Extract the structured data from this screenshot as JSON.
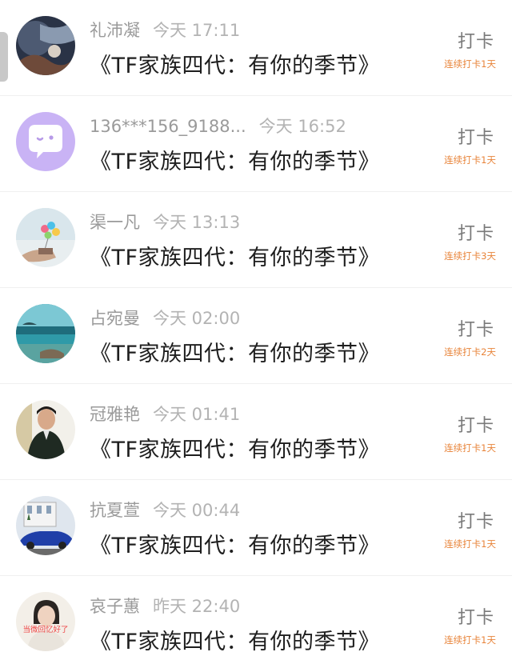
{
  "feed": {
    "items": [
      {
        "name": "礼沛凝",
        "time": "今天 17:11",
        "title": "《TF家族四代：有你的季节》",
        "action": "打卡",
        "streak": "连续打卡1天",
        "avatar": "dark-art-avatar"
      },
      {
        "name": "136***156_9188...",
        "time": "今天 16:52",
        "title": "《TF家族四代：有你的季节》",
        "action": "打卡",
        "streak": "连续打卡1天",
        "avatar": "purple-chat-bubble-avatar"
      },
      {
        "name": "渠一凡",
        "time": "今天 13:13",
        "title": "《TF家族四代：有你的季节》",
        "action": "打卡",
        "streak": "连续打卡3天",
        "avatar": "balloons-avatar"
      },
      {
        "name": "占宛曼",
        "time": "今天 02:00",
        "title": "《TF家族四代：有你的季节》",
        "action": "打卡",
        "streak": "连续打卡2天",
        "avatar": "seascape-avatar"
      },
      {
        "name": "冠雅艳",
        "time": "今天 01:41",
        "title": "《TF家族四代：有你的季节》",
        "action": "打卡",
        "streak": "连续打卡1天",
        "avatar": "man-portrait-avatar"
      },
      {
        "name": "抗夏萱",
        "time": "今天 00:44",
        "title": "《TF家族四代：有你的季节》",
        "action": "打卡",
        "streak": "连续打卡1天",
        "avatar": "blue-car-avatar"
      },
      {
        "name": "哀子蕙",
        "time": "昨天 22:40",
        "title": "《TF家族四代：有你的季节》",
        "action": "打卡",
        "streak": "连续打卡1天",
        "avatar": "girl-portrait-avatar",
        "avatar_text": "当微回忆好了"
      }
    ]
  },
  "colors": {
    "streak": "#e8843a",
    "meta": "#9a9a9a",
    "title": "#1e1e1e",
    "action": "#7a7a7a"
  }
}
